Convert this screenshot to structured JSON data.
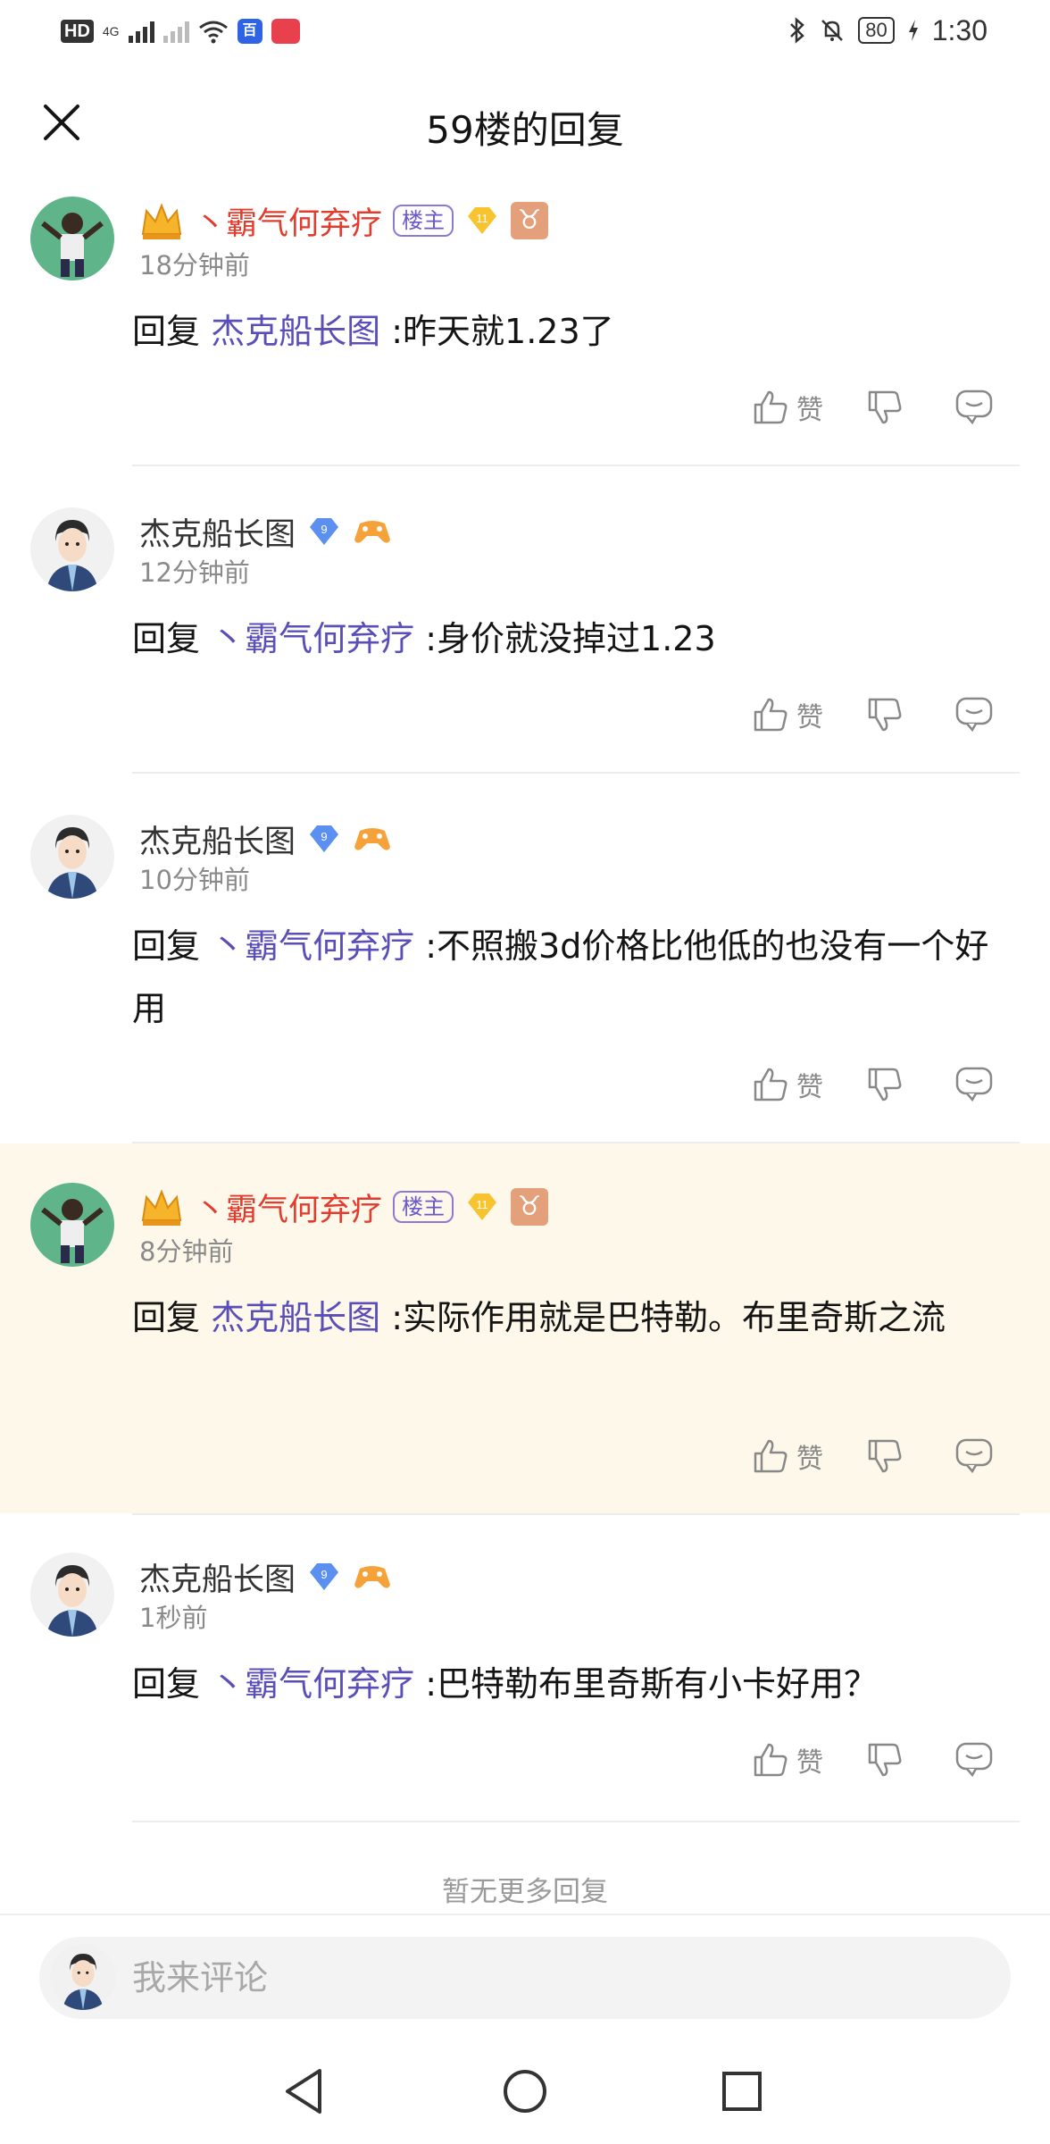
{
  "status_bar": {
    "hd": "HD",
    "sim": "4G",
    "battery": "80",
    "time": "1:30",
    "app_icon_1": "百"
  },
  "header": {
    "title": "59楼的回复",
    "close_icon": "close-icon"
  },
  "comments": [
    {
      "username": "丶霸气何弃疗",
      "is_author": true,
      "owner_badge": "楼主",
      "level": "11",
      "zodiac": "♉",
      "time": "18分钟前",
      "reply_prefix": "回复",
      "reply_to": "杰克船长图",
      "text": ":昨天就1.23了",
      "like_label": "赞"
    },
    {
      "username": "杰克船长图",
      "is_author": false,
      "level": "9",
      "time": "12分钟前",
      "reply_prefix": "回复",
      "reply_to": "丶霸气何弃疗",
      "text": ":身价就没掉过1.23",
      "like_label": "赞"
    },
    {
      "username": "杰克船长图",
      "is_author": false,
      "level": "9",
      "time": "10分钟前",
      "reply_prefix": "回复",
      "reply_to": "丶霸气何弃疗",
      "text": ":不照搬3d价格比他低的也没有一个好用",
      "like_label": "赞"
    },
    {
      "username": "丶霸气何弃疗",
      "is_author": true,
      "owner_badge": "楼主",
      "level": "11",
      "zodiac": "♉",
      "time": "8分钟前",
      "reply_prefix": "回复",
      "reply_to": "杰克船长图",
      "text": ":实际作用就是巴特勒。布里奇斯之流",
      "like_label": "赞"
    },
    {
      "username": "杰克船长图",
      "is_author": false,
      "level": "9",
      "time": "1秒前",
      "reply_prefix": "回复",
      "reply_to": "丶霸气何弃疗",
      "text": ":巴特勒布里奇斯有小卡好用？",
      "like_label": "赞"
    }
  ],
  "no_more_text": "暂无更多回复",
  "comment_input": {
    "placeholder": "我来评论"
  },
  "colors": {
    "author_name": "#e13c2e",
    "reply_target": "#5a4fb8",
    "highlight_bg": "#fdf8ea",
    "owner_badge": "#6b59c9"
  }
}
